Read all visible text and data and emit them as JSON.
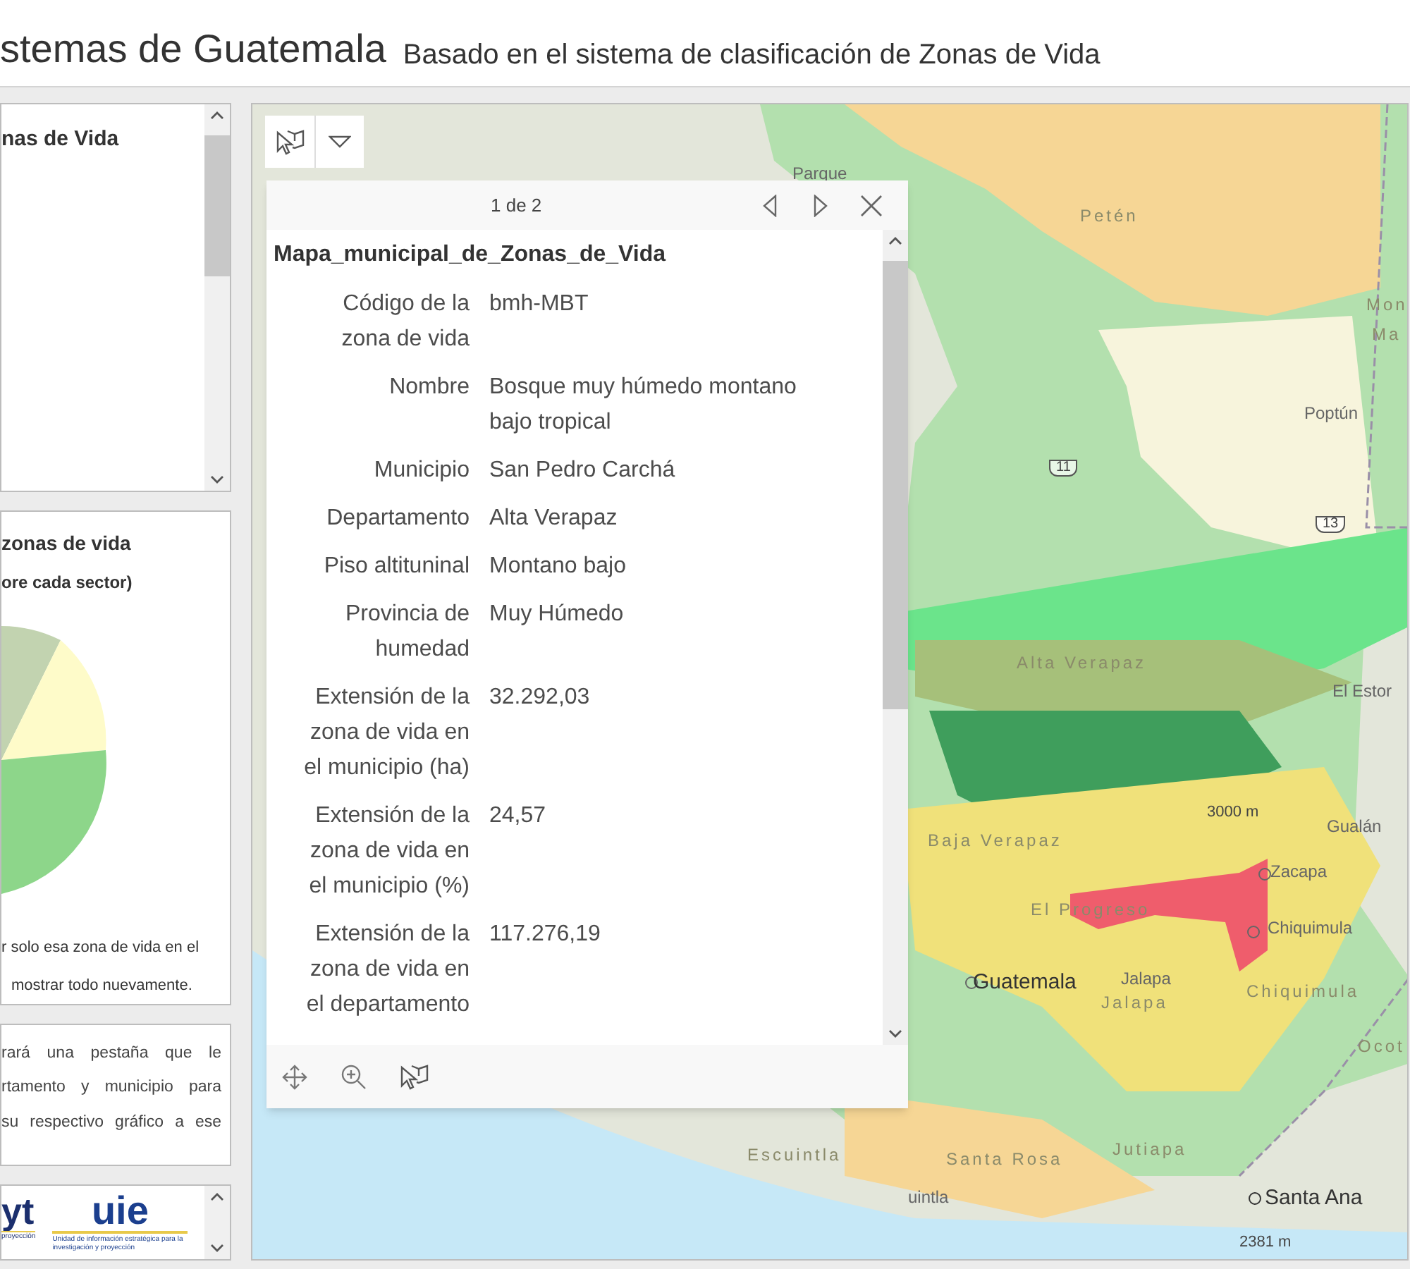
{
  "header": {
    "title": "stemas de Guatemala",
    "subtitle": "Basado en el sistema de clasificación de Zonas de Vida"
  },
  "left_panels": [
    {
      "kind": "title",
      "title": "nas de Vida"
    },
    {
      "kind": "chart",
      "title": "zonas de vida",
      "subtitle": "ore cada sector)",
      "notes": [
        "r solo esa zona de vida en el",
        "mostrar todo nuevamente."
      ]
    },
    {
      "kind": "text",
      "lines": [
        "rará una pestaña que le",
        "rtamento y municipio para",
        "su respectivo gráfico a ese"
      ]
    },
    {
      "kind": "logos",
      "logo_1": "yt",
      "logo_1_caption": "proyección",
      "logo_2": "uie",
      "logo_2_caption": "Unidad de información estratégica para la investigación y proyección"
    }
  ],
  "map": {
    "labels": [
      {
        "text": "Parque",
        "kind": "place"
      },
      {
        "text": "Petén",
        "kind": "region"
      },
      {
        "text": "Mon",
        "kind": "region"
      },
      {
        "text": "Ma",
        "kind": "region"
      },
      {
        "text": "Poptún",
        "kind": "place"
      },
      {
        "text": "11",
        "kind": "shield"
      },
      {
        "text": "13",
        "kind": "shield"
      },
      {
        "text": "Alta Verapaz",
        "kind": "region"
      },
      {
        "text": "El Estor",
        "kind": "place"
      },
      {
        "text": "3000 m",
        "kind": "peak"
      },
      {
        "text": "Gualán",
        "kind": "place"
      },
      {
        "text": "Baja Verapaz",
        "kind": "region"
      },
      {
        "text": "Zacapa",
        "kind": "place"
      },
      {
        "text": "El Progreso",
        "kind": "region"
      },
      {
        "text": "Chiquimula",
        "kind": "place"
      },
      {
        "text": "Guatemala",
        "kind": "city"
      },
      {
        "text": "Jalapa",
        "kind": "place"
      },
      {
        "text": "Jalapa",
        "kind": "region"
      },
      {
        "text": "Chiquimula",
        "kind": "region"
      },
      {
        "text": "Ocot",
        "kind": "region"
      },
      {
        "text": "Escuintla",
        "kind": "region"
      },
      {
        "text": "Santa Rosa",
        "kind": "region"
      },
      {
        "text": "Jutiapa",
        "kind": "region"
      },
      {
        "text": "uintla",
        "kind": "place"
      },
      {
        "text": "Santa Ana",
        "kind": "city"
      },
      {
        "text": "2381 m",
        "kind": "peak"
      }
    ]
  },
  "popup": {
    "pager": "1 de 2",
    "title": "Mapa_municipal_de_Zonas_de_Vida",
    "fields": [
      {
        "label": "Código de la zona de vida",
        "value": "bmh-MBT"
      },
      {
        "label": "Nombre",
        "value": "Bosque muy húmedo montano bajo tropical"
      },
      {
        "label": "Municipio",
        "value": "San Pedro Carchá"
      },
      {
        "label": "Departamento",
        "value": "Alta Verapaz"
      },
      {
        "label": "Piso altituninal",
        "value": "Montano bajo"
      },
      {
        "label": "Provincia de humedad",
        "value": "Muy Húmedo"
      },
      {
        "label": "Extensión de la zona de vida en el municipio (ha)",
        "value": "32.292,03"
      },
      {
        "label": "Extensión de la zona de vida en el municipio (%)",
        "value": "24,57"
      },
      {
        "label": "Extensión de la zona de vida en el departamento",
        "value": "117.276,19"
      }
    ]
  }
}
